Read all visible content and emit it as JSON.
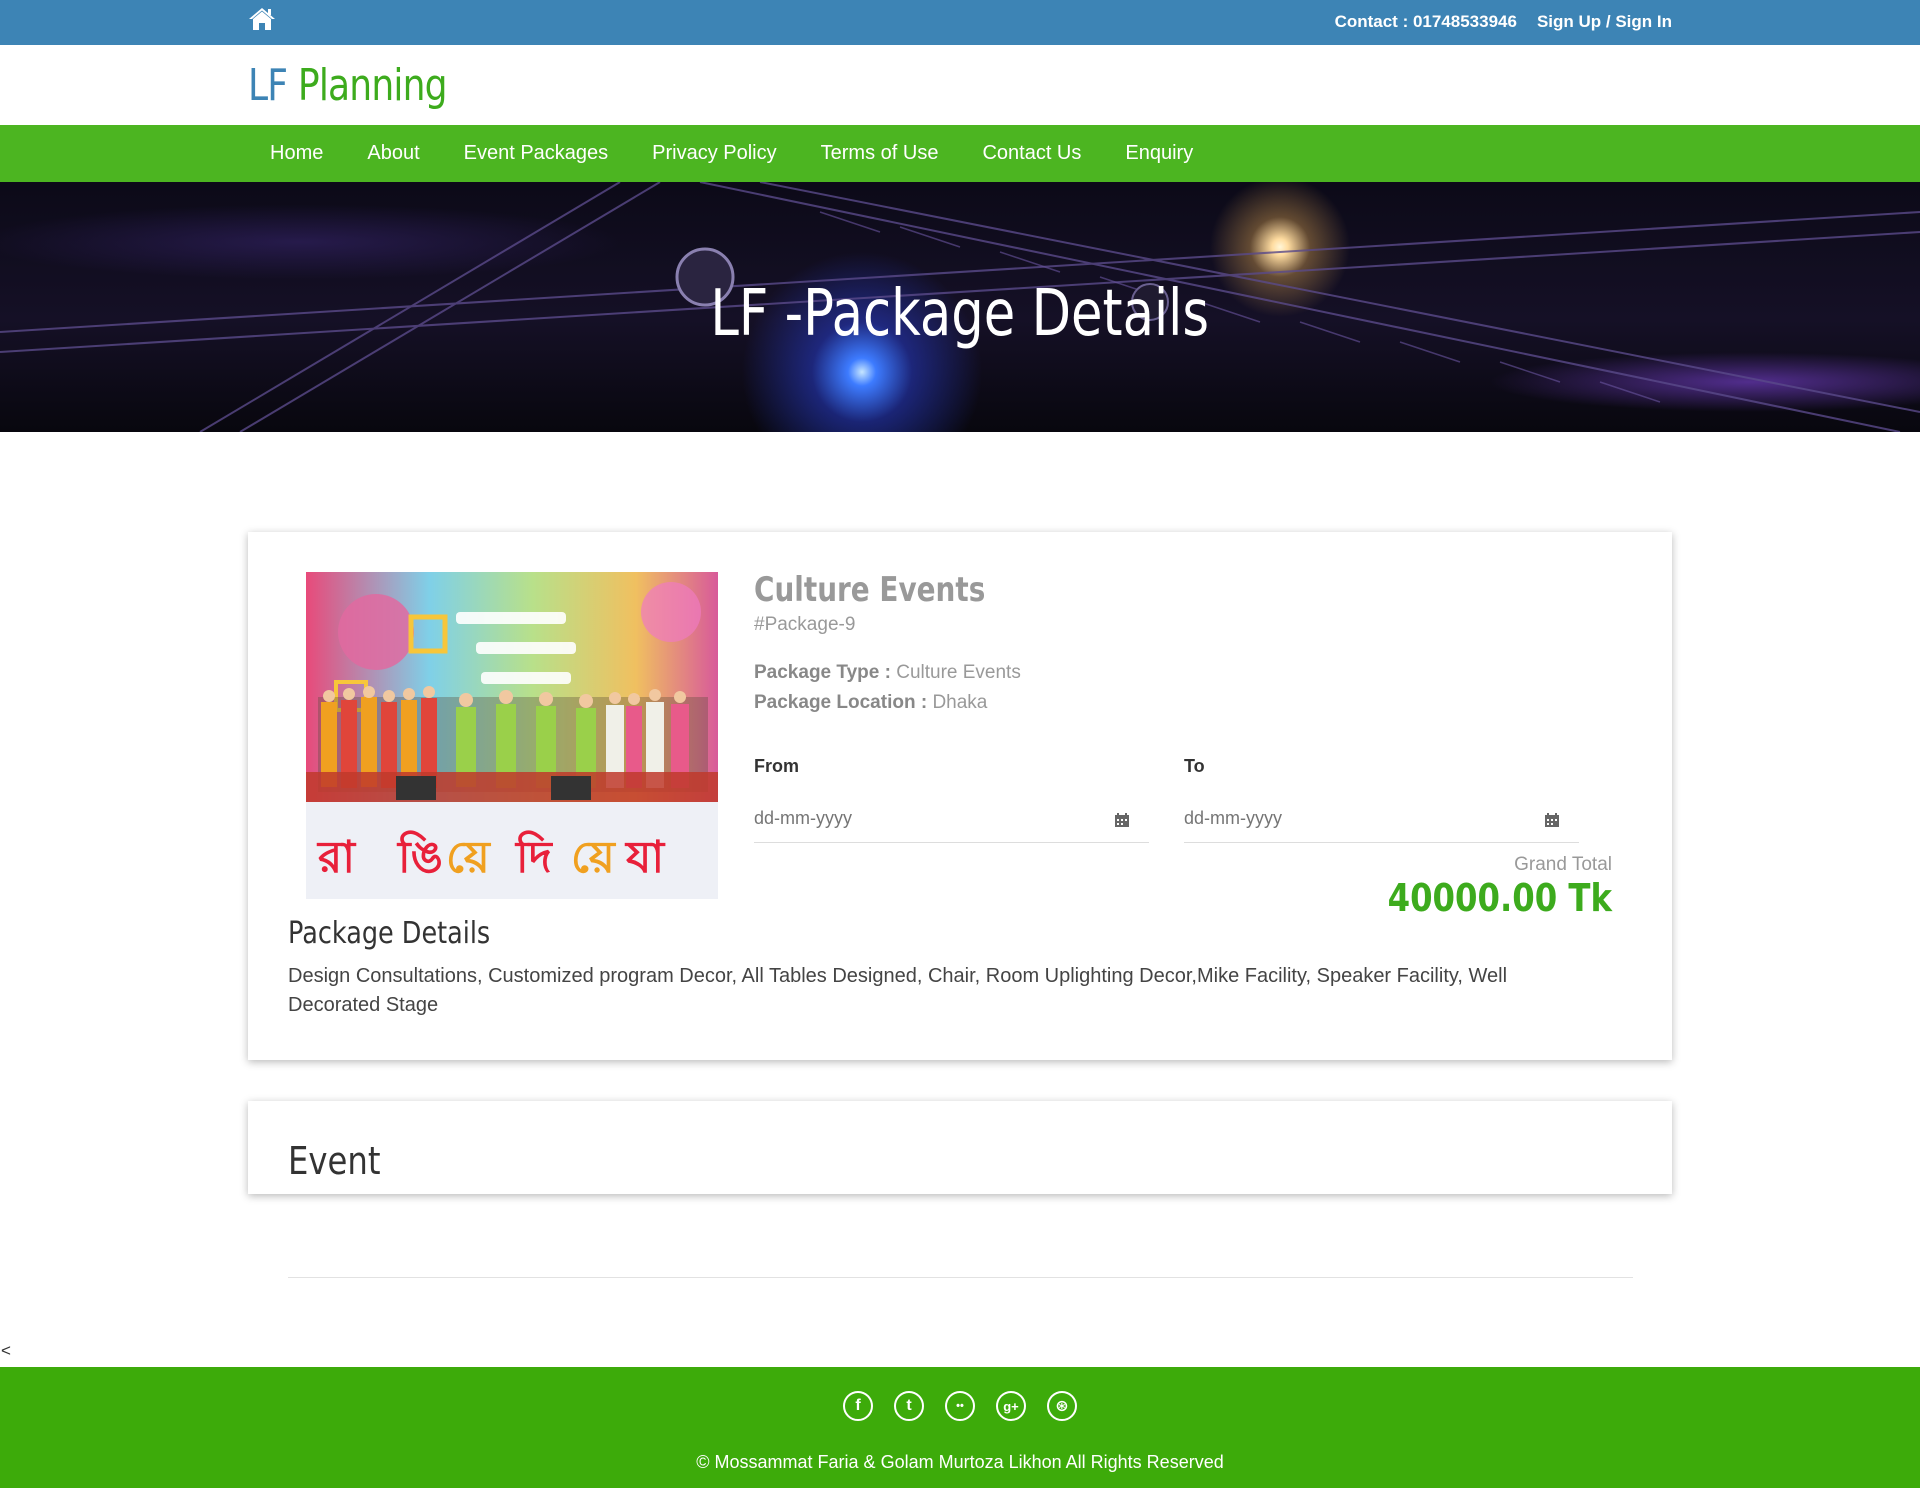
{
  "topbar": {
    "contact": "Contact : 01748533946",
    "auth": "Sign Up / Sign In"
  },
  "logo": {
    "part1": "LF",
    "part2": "Planning"
  },
  "nav": {
    "items": [
      "Home",
      "About",
      "Event Packages",
      "Privacy Policy",
      "Terms of Use",
      "Contact Us",
      "Enquiry"
    ]
  },
  "hero": {
    "title": "LF -Package Details"
  },
  "package": {
    "title": "Culture Events",
    "id": "#Package-9",
    "type_label": "Package Type :",
    "type_value": "Culture Events",
    "location_label": "Package Location :",
    "location_value": "Dhaka",
    "from_label": "From",
    "to_label": "To",
    "from_placeholder": "dd-mm-yyyy",
    "to_placeholder": "dd-mm-yyyy",
    "grand_total_label": "Grand Total",
    "grand_total_value": "40000.00 Tk",
    "details_title": "Package Details",
    "details_text": "Design Consultations, Customized program Decor, All Tables Designed, Chair, Room Uplighting Decor,Mike Facility, Speaker Facility, Well Decorated Stage"
  },
  "event": {
    "title": "Event"
  },
  "stray_char": "<",
  "footer": {
    "socials": [
      {
        "icon": "facebook-icon",
        "glyph": "f"
      },
      {
        "icon": "twitter-icon",
        "glyph": "t"
      },
      {
        "icon": "flickr-icon",
        "glyph": "••"
      },
      {
        "icon": "google-plus-icon",
        "glyph": "g+"
      },
      {
        "icon": "dribbble-icon",
        "glyph": "⊛"
      }
    ],
    "copyright": "© Mossammat Faria & Golam Murtoza Likhon All Rights Reserved"
  },
  "colors": {
    "topbar": "#3d84b5",
    "nav": "#4cb521",
    "accent_green": "#3dab1d",
    "footer": "#3dab0a"
  }
}
